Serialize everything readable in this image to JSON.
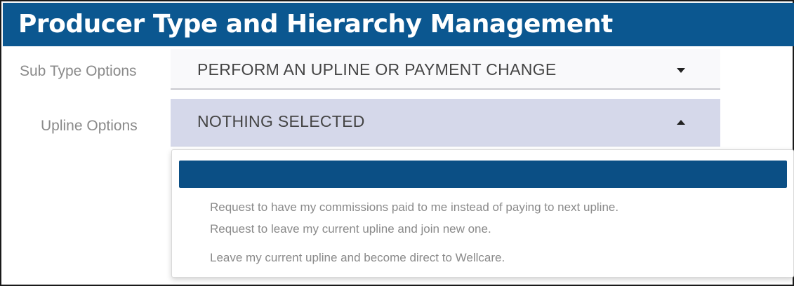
{
  "header": {
    "title": "Producer Type and Hierarchy Management"
  },
  "form": {
    "sub_type": {
      "label": "Sub Type Options",
      "value": "PERFORM AN UPLINE OR PAYMENT CHANGE",
      "icon": "chevron-down-icon"
    },
    "upline": {
      "label": "Upline Options",
      "value": "NOTHING SELECTED",
      "icon": "chevron-up-icon",
      "options": [
        "",
        "Request to have my commissions paid to me instead of paying to next upline.",
        "Request to leave my current upline and join new one.",
        "Leave my current upline and become direct to Wellcare."
      ]
    }
  },
  "colors": {
    "header_bg": "#0b5790",
    "highlight": "#0b4f85",
    "open_select_bg": "#d5d8ea"
  }
}
